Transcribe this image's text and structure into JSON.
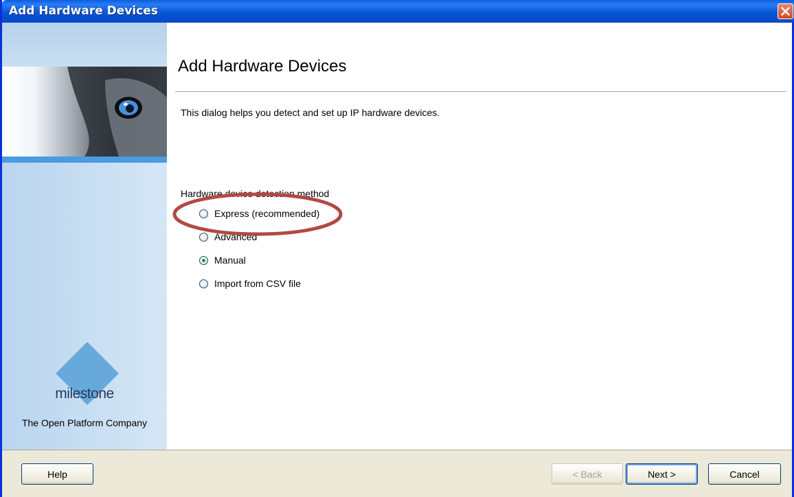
{
  "window": {
    "title": "Add Hardware Devices"
  },
  "sidebar": {
    "logo_text": "milestone",
    "tagline": "The Open Platform Company"
  },
  "main": {
    "heading": "Add Hardware Devices",
    "description": "This dialog helps you detect and set up IP hardware devices.",
    "group_label": "Hardware device detection method",
    "options": [
      {
        "label": "Express (recommended)",
        "selected": false
      },
      {
        "label": "Advanced",
        "selected": false
      },
      {
        "label": "Manual",
        "selected": true
      },
      {
        "label": "Import from CSV file",
        "selected": false
      }
    ]
  },
  "footer": {
    "help": "Help",
    "back": "< Back",
    "next": "Next >",
    "cancel": "Cancel"
  },
  "colors": {
    "titlebar": "#0755d8",
    "highlight_oval": "#b04a43",
    "selected_dot": "#21a121"
  }
}
